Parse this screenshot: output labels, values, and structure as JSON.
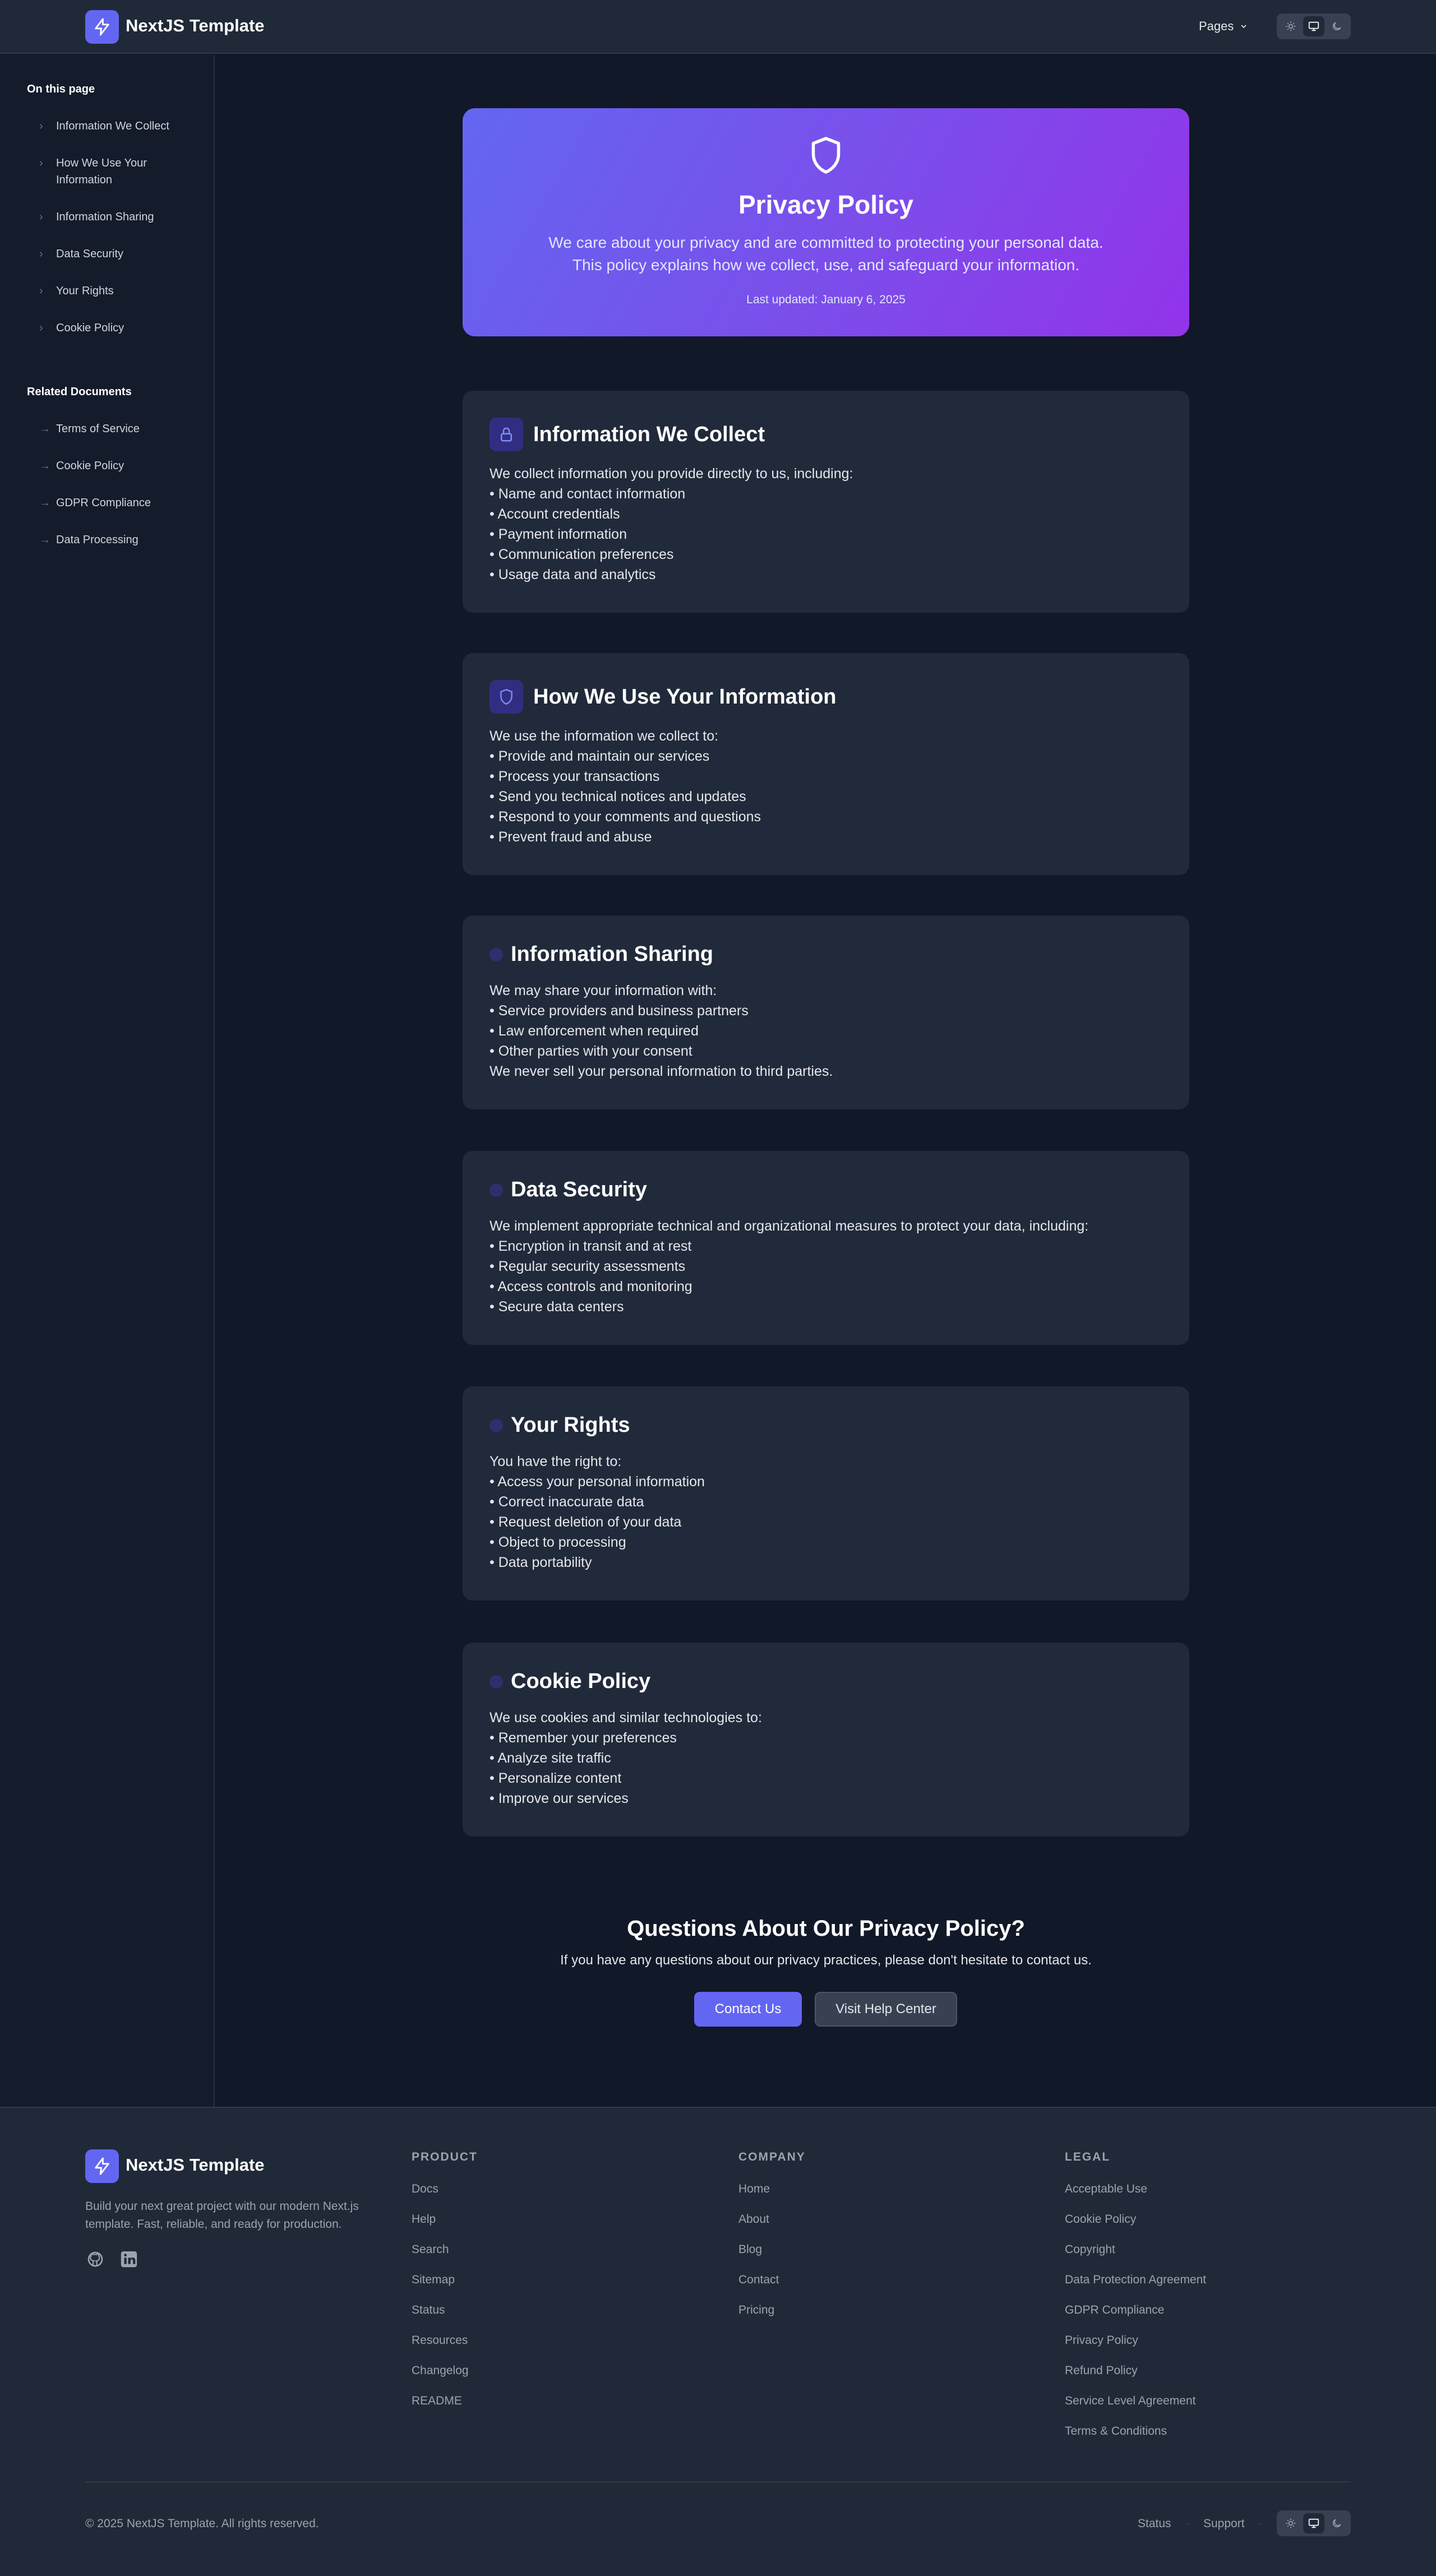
{
  "header": {
    "brand": "NextJS Template",
    "pages_label": "Pages",
    "theme_options": [
      "light",
      "system",
      "dark"
    ],
    "theme_selected": "system"
  },
  "sidebar": {
    "on_this_page_title": "On this page",
    "on_this_page": [
      "Information We Collect",
      "How We Use Your Information",
      "Information Sharing",
      "Data Security",
      "Your Rights",
      "Cookie Policy"
    ],
    "related_title": "Related Documents",
    "related": [
      "Terms of Service",
      "Cookie Policy",
      "GDPR Compliance",
      "Data Processing"
    ]
  },
  "hero": {
    "title": "Privacy Policy",
    "description": "We care about your privacy and are committed to protecting your personal data. This policy explains how we collect, use, and safeguard your information.",
    "last_updated": "Last updated: January 6, 2025"
  },
  "sections": [
    {
      "title": "Information We Collect",
      "icon": "lock-icon",
      "lines": [
        "We collect information you provide directly to us, including:",
        "• Name and contact information",
        "• Account credentials",
        "• Payment information",
        "• Communication preferences",
        "• Usage data and analytics"
      ]
    },
    {
      "title": "How We Use Your Information",
      "icon": "shield-icon",
      "lines": [
        "We use the information we collect to:",
        "• Provide and maintain our services",
        "• Process your transactions",
        "• Send you technical notices and updates",
        "• Respond to your comments and questions",
        "• Prevent fraud and abuse"
      ]
    },
    {
      "title": "Information Sharing",
      "icon": "dot-icon",
      "lines": [
        "We may share your information with:",
        "• Service providers and business partners",
        "• Law enforcement when required",
        "• Other parties with your consent",
        "We never sell your personal information to third parties."
      ]
    },
    {
      "title": "Data Security",
      "icon": "dot-icon",
      "lines": [
        "We implement appropriate technical and organizational measures to protect your data, including:",
        "• Encryption in transit and at rest",
        "• Regular security assessments",
        "• Access controls and monitoring",
        "• Secure data centers"
      ]
    },
    {
      "title": "Your Rights",
      "icon": "dot-icon",
      "lines": [
        "You have the right to:",
        "• Access your personal information",
        "• Correct inaccurate data",
        "• Request deletion of your data",
        "• Object to processing",
        "• Data portability"
      ]
    },
    {
      "title": "Cookie Policy",
      "icon": "dot-icon",
      "lines": [
        "We use cookies and similar technologies to:",
        "• Remember your preferences",
        "• Analyze site traffic",
        "• Personalize content",
        "• Improve our services"
      ]
    }
  ],
  "cta": {
    "title": "Questions About Our Privacy Policy?",
    "description": "If you have any questions about our privacy practices, please don't hesitate to contact us.",
    "primary_button": "Contact Us",
    "secondary_button": "Visit Help Center"
  },
  "footer": {
    "brand": "NextJS Template",
    "description": "Build your next great project with our modern Next.js template. Fast, reliable, and ready for production.",
    "social": [
      "github-icon",
      "linkedin-icon"
    ],
    "columns": [
      {
        "title": "PRODUCT",
        "links": [
          "Docs",
          "Help",
          "Search",
          "Sitemap",
          "Status",
          "Resources",
          "Changelog",
          "README"
        ]
      },
      {
        "title": "COMPANY",
        "links": [
          "Home",
          "About",
          "Blog",
          "Contact",
          "Pricing"
        ]
      },
      {
        "title": "LEGAL",
        "links": [
          "Acceptable Use",
          "Cookie Policy",
          "Copyright",
          "Data Protection Agreement",
          "GDPR Compliance",
          "Privacy Policy",
          "Refund Policy",
          "Service Level Agreement",
          "Terms & Conditions"
        ]
      }
    ],
    "copyright": "© 2025 NextJS Template. All rights reserved.",
    "bottom_links": [
      "Status",
      "Support"
    ],
    "colors": {
      "accent": "#6366f1",
      "hero_end": "#9333ea",
      "background": "#111827",
      "card": "#212a3a"
    }
  }
}
